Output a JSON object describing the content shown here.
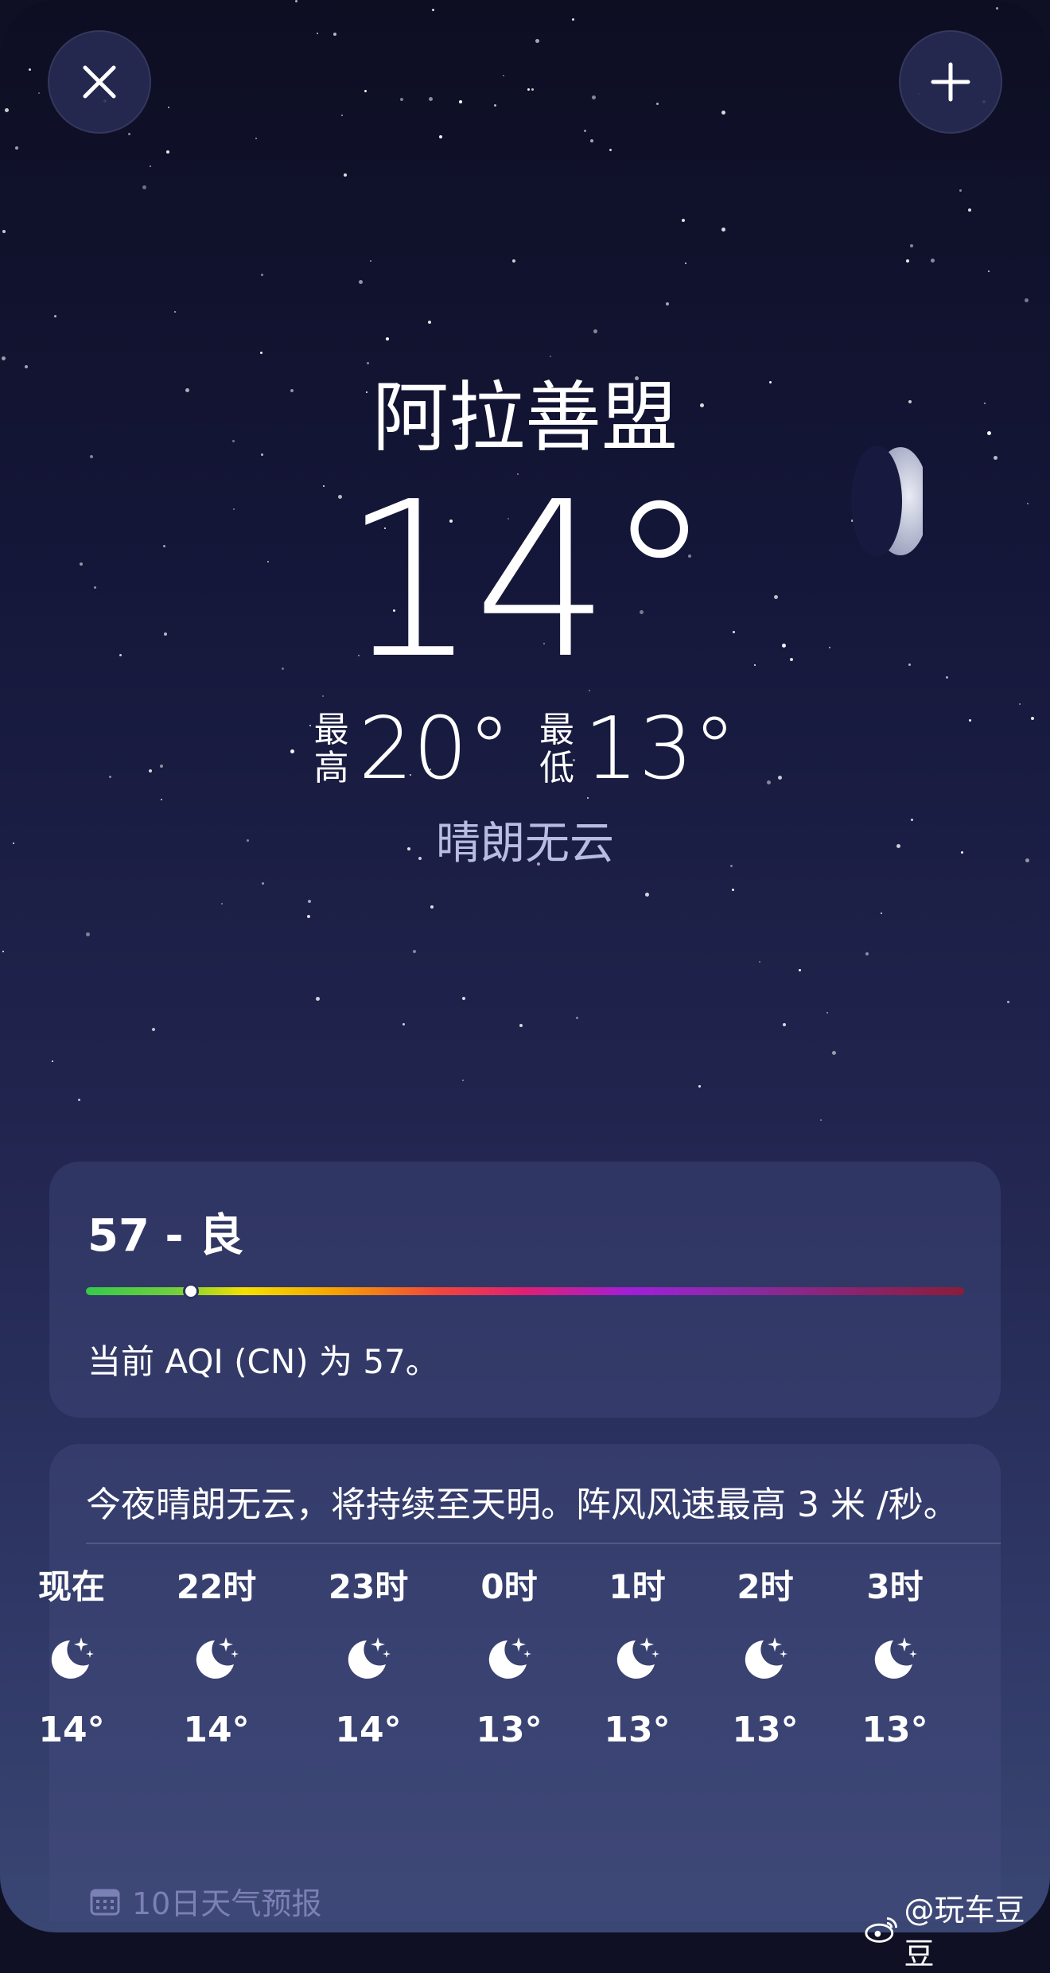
{
  "header": {
    "close_icon": "close-icon",
    "add_icon": "plus-icon"
  },
  "current": {
    "city": "阿拉善盟",
    "temperature": "14°",
    "high_label_1": "最",
    "high_label_2": "高",
    "high_value": "20°",
    "low_label_1": "最",
    "low_label_2": "低",
    "low_value": "13°",
    "condition": "晴朗无云"
  },
  "aqi": {
    "title": "57 - 良",
    "value": 57,
    "description": "当前 AQI (CN) 为 57。"
  },
  "hourly": {
    "summary": "今夜晴朗无云，将持续至天明。阵风风速最高 3 米 /秒。",
    "hours": [
      {
        "label": "现在",
        "icon": "moon-stars-icon",
        "temp": "14°"
      },
      {
        "label": "22时",
        "icon": "moon-stars-icon",
        "temp": "14°"
      },
      {
        "label": "23时",
        "icon": "moon-stars-icon",
        "temp": "14°"
      },
      {
        "label": "0时",
        "icon": "moon-stars-icon",
        "temp": "13°"
      },
      {
        "label": "1时",
        "icon": "moon-stars-icon",
        "temp": "13°"
      },
      {
        "label": "2时",
        "icon": "moon-stars-icon",
        "temp": "13°"
      },
      {
        "label": "3时",
        "icon": "moon-stars-icon",
        "temp": "13°"
      }
    ]
  },
  "forecast": {
    "header": "10日天气预报",
    "icon": "calendar-icon"
  },
  "watermark": {
    "text": "@玩车豆豆",
    "icon": "weibo-icon"
  },
  "colors": {
    "condition": "#b9bce2",
    "card": "#464e80",
    "forecast_header": "#7b81b4"
  }
}
